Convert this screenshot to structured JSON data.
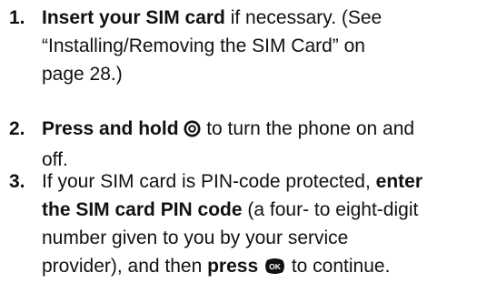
{
  "steps": [
    {
      "number": "1.",
      "lines": [
        [
          {
            "t": "Insert your SIM card",
            "bold": true
          },
          {
            "t": " if necessary. (See"
          }
        ],
        [
          {
            "t": "“Installing/Removing the SIM Card” on"
          }
        ],
        [
          {
            "t": "page 28.)"
          }
        ]
      ]
    },
    {
      "number": "2.",
      "lines": [
        [
          {
            "t": "Press and hold ",
            "bold": true
          },
          {
            "icon": "power-key-icon"
          },
          {
            "t": " to turn the phone on and"
          }
        ],
        [
          {
            "t": "off."
          }
        ]
      ]
    },
    {
      "number": "3.",
      "lines": [
        [
          {
            "t": "If your SIM card is PIN-code protected, "
          },
          {
            "t": "enter",
            "bold": true
          }
        ],
        [
          {
            "t": "the SIM card PIN code",
            "bold": true
          },
          {
            "t": " (a four- to eight-digit"
          }
        ],
        [
          {
            "t": "number given to you by your service"
          }
        ],
        [
          {
            "t": "provider), and then "
          },
          {
            "t": "press ",
            "bold": true
          },
          {
            "icon": "ok-key-icon"
          },
          {
            "t": " to continue."
          }
        ]
      ]
    }
  ],
  "icons": {
    "power-key-icon": {
      "color": "#111111"
    },
    "ok-key-icon": {
      "color": "#111111",
      "label": "OK"
    }
  }
}
